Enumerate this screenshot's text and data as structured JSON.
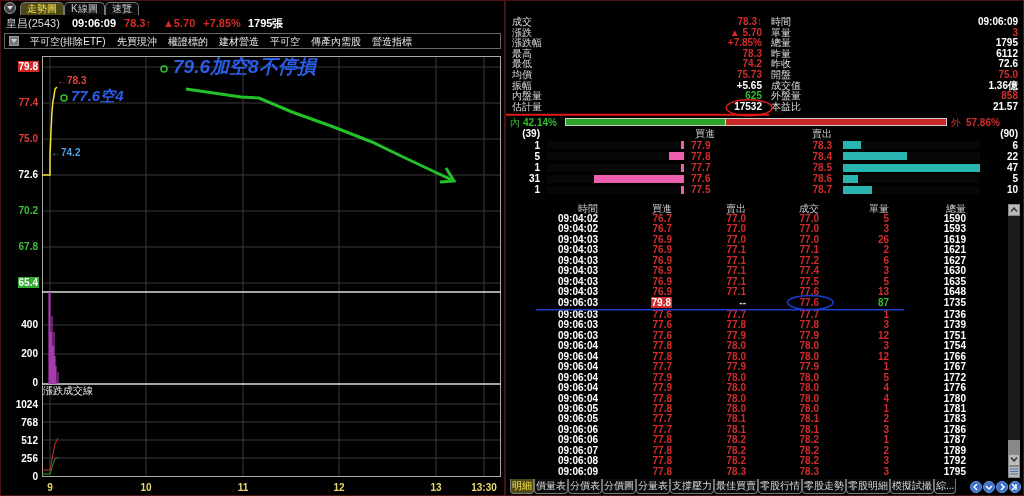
{
  "chart_tabs": [
    {
      "label": "走勢圖",
      "selected": true
    },
    {
      "label": "K線圖",
      "selected": false
    },
    {
      "label": "速覽",
      "selected": false
    }
  ],
  "quote": {
    "name": "皇昌(2543)",
    "time": "09:06:09",
    "price": "78.3↑",
    "change": "▲5.70",
    "change_pct": "+7.85%",
    "volume": "1795張"
  },
  "filter": {
    "items": [
      "平可空(排除ETF)",
      "先買現沖",
      "權證標的",
      "建材營造",
      "平可空",
      "傳產內需股",
      "營造指標"
    ]
  },
  "chart": {
    "price_labels": [
      {
        "text": "79.8",
        "kind": "limit_up"
      },
      {
        "text": "77.4",
        "kind": "up"
      },
      {
        "text": "75.0",
        "kind": "up"
      },
      {
        "text": "72.6",
        "kind": "flat"
      },
      {
        "text": "70.2",
        "kind": "down"
      },
      {
        "text": "67.8",
        "kind": "down"
      },
      {
        "text": "65.4",
        "kind": "limit_down"
      }
    ],
    "price_markers": [
      {
        "text": "←78.3",
        "kind": "high"
      },
      {
        "text": "←74.2",
        "kind": "low"
      }
    ],
    "notes": [
      {
        "text": "79.6加空8不停損"
      },
      {
        "text": "77.6空4"
      }
    ],
    "volume_labels": [
      "400",
      "200",
      "0"
    ],
    "indicator_title": "漲跌成交線",
    "indicator_labels": [
      "1024",
      "768",
      "512",
      "256",
      "0"
    ],
    "time_labels": [
      "9",
      "10",
      "11",
      "12",
      "13",
      "13:30"
    ]
  },
  "stats": [
    {
      "label": "成交",
      "value": "78.3↑",
      "color": "#d42c2c"
    },
    {
      "label": "時間",
      "value": "09:06:09",
      "color": "#ffffff"
    },
    {
      "label": "漲跌",
      "value": "▲ 5.70",
      "color": "#d42c2c"
    },
    {
      "label": "單量",
      "value": "3",
      "color": "#d42c2c"
    },
    {
      "label": "漲跌幅",
      "value": "+7.85%",
      "color": "#d42c2c"
    },
    {
      "label": "總量",
      "value": "1795",
      "color": "#ffffff"
    },
    {
      "label": "最高",
      "value": "78.3",
      "color": "#d42c2c"
    },
    {
      "label": "昨量",
      "value": "6112",
      "color": "#ffffff"
    },
    {
      "label": "最低",
      "value": "74.2",
      "color": "#d42c2c"
    },
    {
      "label": "昨收",
      "value": "72.6",
      "color": "#ffffff"
    },
    {
      "label": "均價",
      "value": "75.73",
      "color": "#d42c2c"
    },
    {
      "label": "開盤",
      "value": "75.0",
      "color": "#d42c2c"
    },
    {
      "label": "振幅",
      "value": "+5.65",
      "color": "#ffffff"
    },
    {
      "label": "成交值",
      "value": "1.36億",
      "color": "#ffffff"
    },
    {
      "label": "內盤量",
      "value": "625",
      "color": "#33bb33"
    },
    {
      "label": "外盤量",
      "value": "858",
      "color": "#d42c2c"
    },
    {
      "label": "估計量",
      "value": "17532",
      "color": "#ffffff"
    },
    {
      "label": "本益比",
      "value": "21.57",
      "color": "#ffffff"
    }
  ],
  "inout": {
    "inner_label": "內",
    "inner_value": "42.14%",
    "outer_label": "外",
    "outer_value": "57.86%",
    "level": 0.4214
  },
  "order_book": {
    "bid_total": "(39)",
    "bid_header": "買進",
    "ask_header": "賣出",
    "ask_total": "(90)",
    "rows": [
      {
        "bid": {
          "volume": "1",
          "price": "77.9",
          "level": 0.021
        },
        "ask": {
          "price": "78.3",
          "volume": "6",
          "level": 0.128
        }
      },
      {
        "bid": {
          "volume": "5",
          "price": "77.8",
          "level": 0.106
        },
        "ask": {
          "price": "78.4",
          "volume": "22",
          "level": 0.468
        }
      },
      {
        "bid": {
          "volume": "1",
          "price": "77.7",
          "level": 0.021
        },
        "ask": {
          "price": "78.5",
          "volume": "47",
          "level": 1
        }
      },
      {
        "bid": {
          "volume": "31",
          "price": "77.6",
          "level": 0.66
        },
        "ask": {
          "price": "78.6",
          "volume": "5",
          "level": 0.106
        }
      },
      {
        "bid": {
          "volume": "1",
          "price": "77.5",
          "level": 0.021
        },
        "ask": {
          "price": "78.7",
          "volume": "10",
          "level": 0.213
        }
      }
    ]
  },
  "trades": {
    "columns": [
      "時間",
      "買進",
      "賣出",
      "成交",
      "單量",
      "總量"
    ],
    "rows": [
      {
        "time": "09:04:02",
        "bid": "76.7",
        "ask": "77.0",
        "price": "77.0",
        "volume": "5",
        "total": "1590",
        "color": "#d42c2c",
        "highlighted": false
      },
      {
        "time": "09:04:02",
        "bid": "76.7",
        "ask": "77.0",
        "price": "77.0",
        "volume": "3",
        "total": "1593",
        "color": "#d42c2c",
        "highlighted": false
      },
      {
        "time": "09:04:03",
        "bid": "76.9",
        "ask": "77.0",
        "price": "77.0",
        "volume": "26",
        "total": "1619",
        "color": "#d42c2c",
        "highlighted": false
      },
      {
        "time": "09:04:03",
        "bid": "76.9",
        "ask": "77.1",
        "price": "77.1",
        "volume": "2",
        "total": "1621",
        "color": "#d42c2c",
        "highlighted": false
      },
      {
        "time": "09:04:03",
        "bid": "76.9",
        "ask": "77.1",
        "price": "77.2",
        "volume": "6",
        "total": "1627",
        "color": "#d42c2c",
        "highlighted": false
      },
      {
        "time": "09:04:03",
        "bid": "76.9",
        "ask": "77.1",
        "price": "77.4",
        "volume": "3",
        "total": "1630",
        "color": "#d42c2c",
        "highlighted": false
      },
      {
        "time": "09:04:03",
        "bid": "76.9",
        "ask": "77.1",
        "price": "77.5",
        "volume": "5",
        "total": "1635",
        "color": "#d42c2c",
        "highlighted": false
      },
      {
        "time": "09:04:03",
        "bid": "76.9",
        "ask": "77.1",
        "price": "77.6",
        "volume": "13",
        "total": "1648",
        "color": "#d42c2c",
        "highlighted": false
      },
      {
        "time": "09:06:03",
        "bid": "79.8",
        "ask": "--",
        "price": "77.6",
        "volume": "87",
        "total": "1735",
        "color": "#33bb33",
        "highlighted": true
      },
      {
        "time": "09:06:03",
        "bid": "77.6",
        "ask": "77.7",
        "price": "77.7",
        "volume": "1",
        "total": "1736",
        "color": "#d42c2c",
        "highlighted": false
      },
      {
        "time": "09:06:03",
        "bid": "77.6",
        "ask": "77.8",
        "price": "77.8",
        "volume": "3",
        "total": "1739",
        "color": "#d42c2c",
        "highlighted": false
      },
      {
        "time": "09:06:03",
        "bid": "77.6",
        "ask": "77.9",
        "price": "77.9",
        "volume": "12",
        "total": "1751",
        "color": "#d42c2c",
        "highlighted": false
      },
      {
        "time": "09:06:04",
        "bid": "77.8",
        "ask": "78.0",
        "price": "78.0",
        "volume": "3",
        "total": "1754",
        "color": "#d42c2c",
        "highlighted": false
      },
      {
        "time": "09:06:04",
        "bid": "77.8",
        "ask": "78.0",
        "price": "78.0",
        "volume": "12",
        "total": "1766",
        "color": "#d42c2c",
        "highlighted": false
      },
      {
        "time": "09:06:04",
        "bid": "77.7",
        "ask": "77.9",
        "price": "77.9",
        "volume": "1",
        "total": "1767",
        "color": "#d42c2c",
        "highlighted": false
      },
      {
        "time": "09:06:04",
        "bid": "77.9",
        "ask": "78.0",
        "price": "78.0",
        "volume": "5",
        "total": "1772",
        "color": "#d42c2c",
        "highlighted": false
      },
      {
        "time": "09:06:04",
        "bid": "77.9",
        "ask": "78.0",
        "price": "78.0",
        "volume": "4",
        "total": "1776",
        "color": "#d42c2c",
        "highlighted": false
      },
      {
        "time": "09:06:04",
        "bid": "77.8",
        "ask": "78.0",
        "price": "78.0",
        "volume": "4",
        "total": "1780",
        "color": "#d42c2c",
        "highlighted": false
      },
      {
        "time": "09:06:05",
        "bid": "77.8",
        "ask": "78.0",
        "price": "78.0",
        "volume": "1",
        "total": "1781",
        "color": "#d42c2c",
        "highlighted": false
      },
      {
        "time": "09:06:05",
        "bid": "77.7",
        "ask": "78.1",
        "price": "78.1",
        "volume": "2",
        "total": "1783",
        "color": "#d42c2c",
        "highlighted": false
      },
      {
        "time": "09:06:06",
        "bid": "77.7",
        "ask": "78.1",
        "price": "78.1",
        "volume": "3",
        "total": "1786",
        "color": "#d42c2c",
        "highlighted": false
      },
      {
        "time": "09:06:06",
        "bid": "77.8",
        "ask": "78.2",
        "price": "78.2",
        "volume": "1",
        "total": "1787",
        "color": "#d42c2c",
        "highlighted": false
      },
      {
        "time": "09:06:07",
        "bid": "77.8",
        "ask": "78.2",
        "price": "78.2",
        "volume": "2",
        "total": "1789",
        "color": "#d42c2c",
        "highlighted": false
      },
      {
        "time": "09:06:08",
        "bid": "77.8",
        "ask": "78.2",
        "price": "78.2",
        "volume": "3",
        "total": "1792",
        "color": "#d42c2c",
        "highlighted": false
      },
      {
        "time": "09:06:09",
        "bid": "77.8",
        "ask": "78.3",
        "price": "78.3",
        "volume": "3",
        "total": "1795",
        "color": "#d42c2c",
        "highlighted": false
      }
    ]
  },
  "bottom_tabs": [
    {
      "label": "明細",
      "selected": true
    },
    {
      "label": "價量表",
      "selected": false
    },
    {
      "label": "分價表",
      "selected": false
    },
    {
      "label": "分價圖",
      "selected": false
    },
    {
      "label": "分量表",
      "selected": false
    },
    {
      "label": "支撐壓力",
      "selected": false
    },
    {
      "label": "最佳買賣",
      "selected": false
    },
    {
      "label": "零股行情",
      "selected": false
    },
    {
      "label": "零股走勢",
      "selected": false
    },
    {
      "label": "零股明細",
      "selected": false
    },
    {
      "label": "模擬試撮",
      "selected": false
    },
    {
      "label": "綜...",
      "selected": false
    }
  ]
}
